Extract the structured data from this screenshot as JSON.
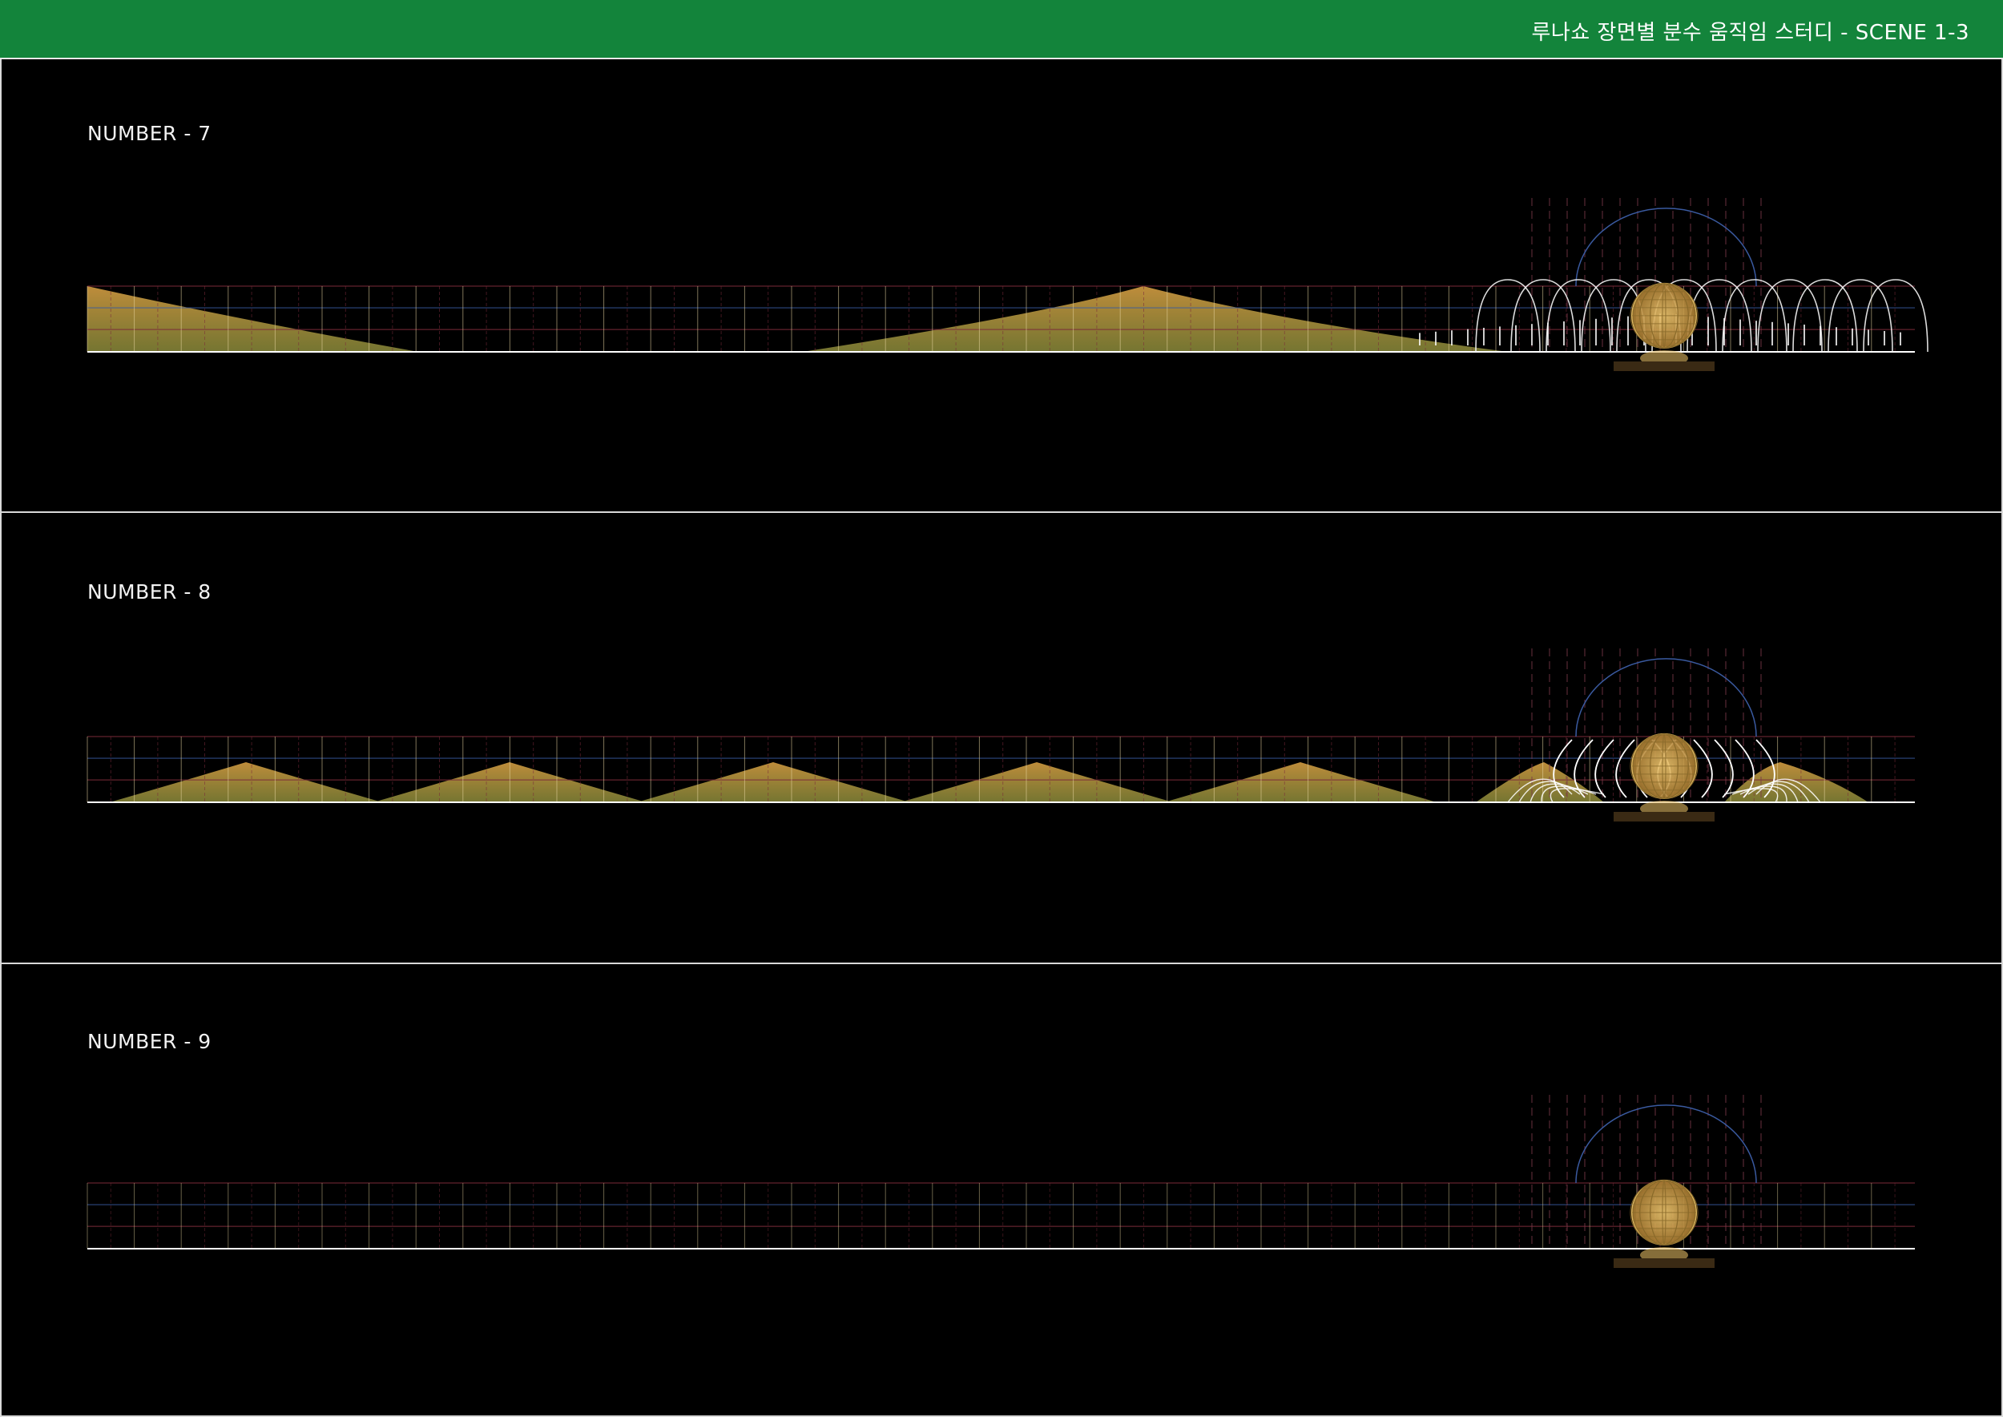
{
  "header": {
    "title": "루나쇼 장면별 분수 움직임 스터디 - SCENE 1-3"
  },
  "scenes": [
    {
      "label": "NUMBER - 7",
      "pattern": "two-wide-peaks"
    },
    {
      "label": "NUMBER - 8",
      "pattern": "five-small-peaks"
    },
    {
      "label": "NUMBER - 9",
      "pattern": "none"
    }
  ],
  "colors": {
    "header_bg": "#13843b",
    "water_fill": "#c9a85a",
    "sphere": "#e0b860",
    "grid_red": "#7a2a3a",
    "grid_blue": "#3a5aa0",
    "ground_line": "#ffffff"
  }
}
